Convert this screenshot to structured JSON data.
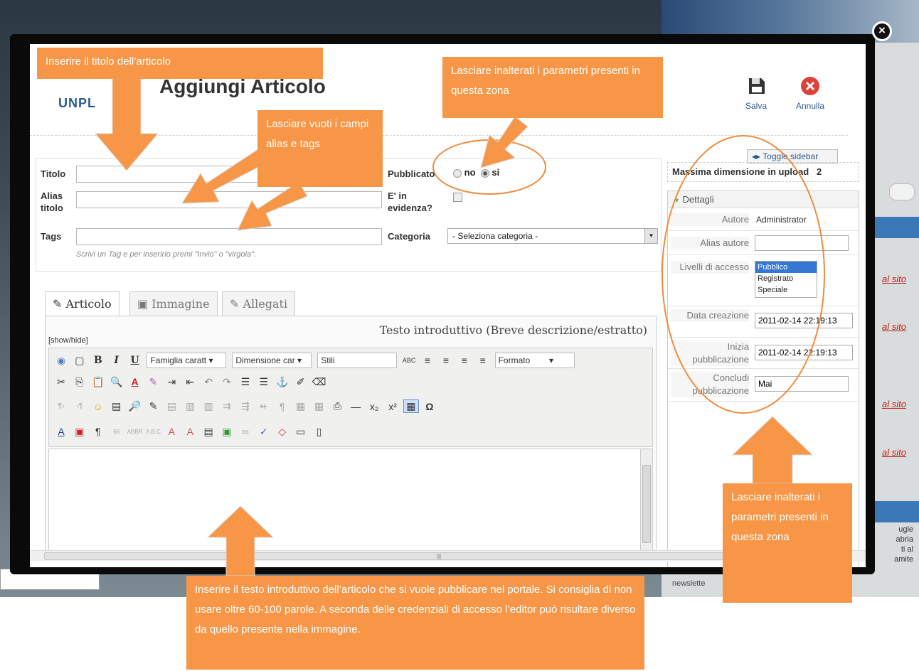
{
  "background": {
    "links": [
      "al sito",
      "al sito",
      "al sito",
      "al sito"
    ],
    "side_texts": [
      "ugle\nabria\nti al\namite"
    ],
    "newsletter": "newslette"
  },
  "modal": {
    "logo": "UNPL",
    "title": "Aggiungi Articolo",
    "toolbar": {
      "save_label": "Salva",
      "cancel_label": "Annulla"
    },
    "form": {
      "titolo_label": "Titolo",
      "alias_label": "Alias titolo",
      "tags_label": "Tags",
      "tags_hint": "Scrivi un Tag e per inserirlo premi \"Invio\" o \"virgola\".",
      "titolo_value": "",
      "alias_value": "",
      "tags_value": "",
      "pubblicato_label": "Pubblicato",
      "radio_no": "no",
      "radio_si": "si",
      "pubblicato_selected": "si",
      "evidenza_label": "E' in evidenza?",
      "evidenza_checked": false,
      "categoria_label": "Categoria",
      "categoria_value": "- Seleziona categoria -"
    },
    "tabs": [
      {
        "label": "Articolo",
        "icon": "edit-icon",
        "active": true
      },
      {
        "label": "Immagine",
        "icon": "image-icon",
        "active": false
      },
      {
        "label": "Allegati",
        "icon": "paperclip-icon",
        "active": false
      }
    ],
    "editor": {
      "intro_title": "Testo introduttivo (Breve descrizione/estratto)",
      "showhide": "[show/hide]",
      "font_family": "Famiglia caratt",
      "font_size": "Dimensione car",
      "styles": "Stili",
      "format": "Formato"
    },
    "sidebar": {
      "toggle_label": "Toggle sidebar",
      "upload_label": "Massima dimensione in upload",
      "upload_value": "2",
      "details_header": "Dettagli",
      "autore_label": "Autore",
      "autore_value": "Administrator",
      "alias_autore_label": "Alias autore",
      "alias_autore_value": "",
      "livelli_label": "Livelli di accesso",
      "livelli_options": [
        "Pubblico",
        "Registrato",
        "Speciale"
      ],
      "livelli_selected": "Pubblico",
      "data_label": "Data creazione",
      "data_value": "2011-02-14 22:19:13",
      "inizia_label": "Inizia pubblicazione",
      "inizia_value": "2011-02-14 22:19:13",
      "concludi_label": "Concludi pubblicazione",
      "concludi_value": "Mai"
    }
  },
  "annotations": {
    "note_titolo": "Inserire il titolo dell’articolo",
    "note_alias": "Lasciare vuoti i campi alias e tags",
    "note_params_top": "Lasciare inalterati i parametri presenti in questa zona",
    "note_params_side": "Lasciare inalterati i parametri presenti in questa zona",
    "note_testo": "Inserire il testo introduttivo dell’articolo che si vuole pubblicare nel portale. Si consiglia di non usare oltre 60-100 parole.  A seconda delle credenziali di accesso l’editor può risultare diverso da quello presente nella immagine."
  },
  "colors": {
    "annotation": "#f79646",
    "modal_bg": "#0a0a0a",
    "link": "#2a5b8c"
  }
}
